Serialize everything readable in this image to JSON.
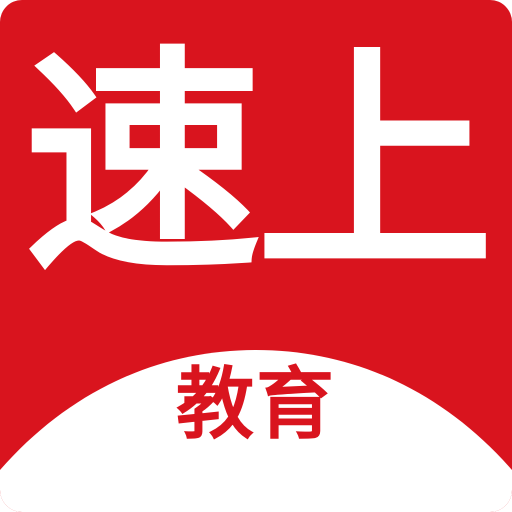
{
  "logo": {
    "title": "速上",
    "subtitle": "教育",
    "colors": {
      "brand_red": "#d9141e",
      "white": "#ffffff"
    }
  }
}
